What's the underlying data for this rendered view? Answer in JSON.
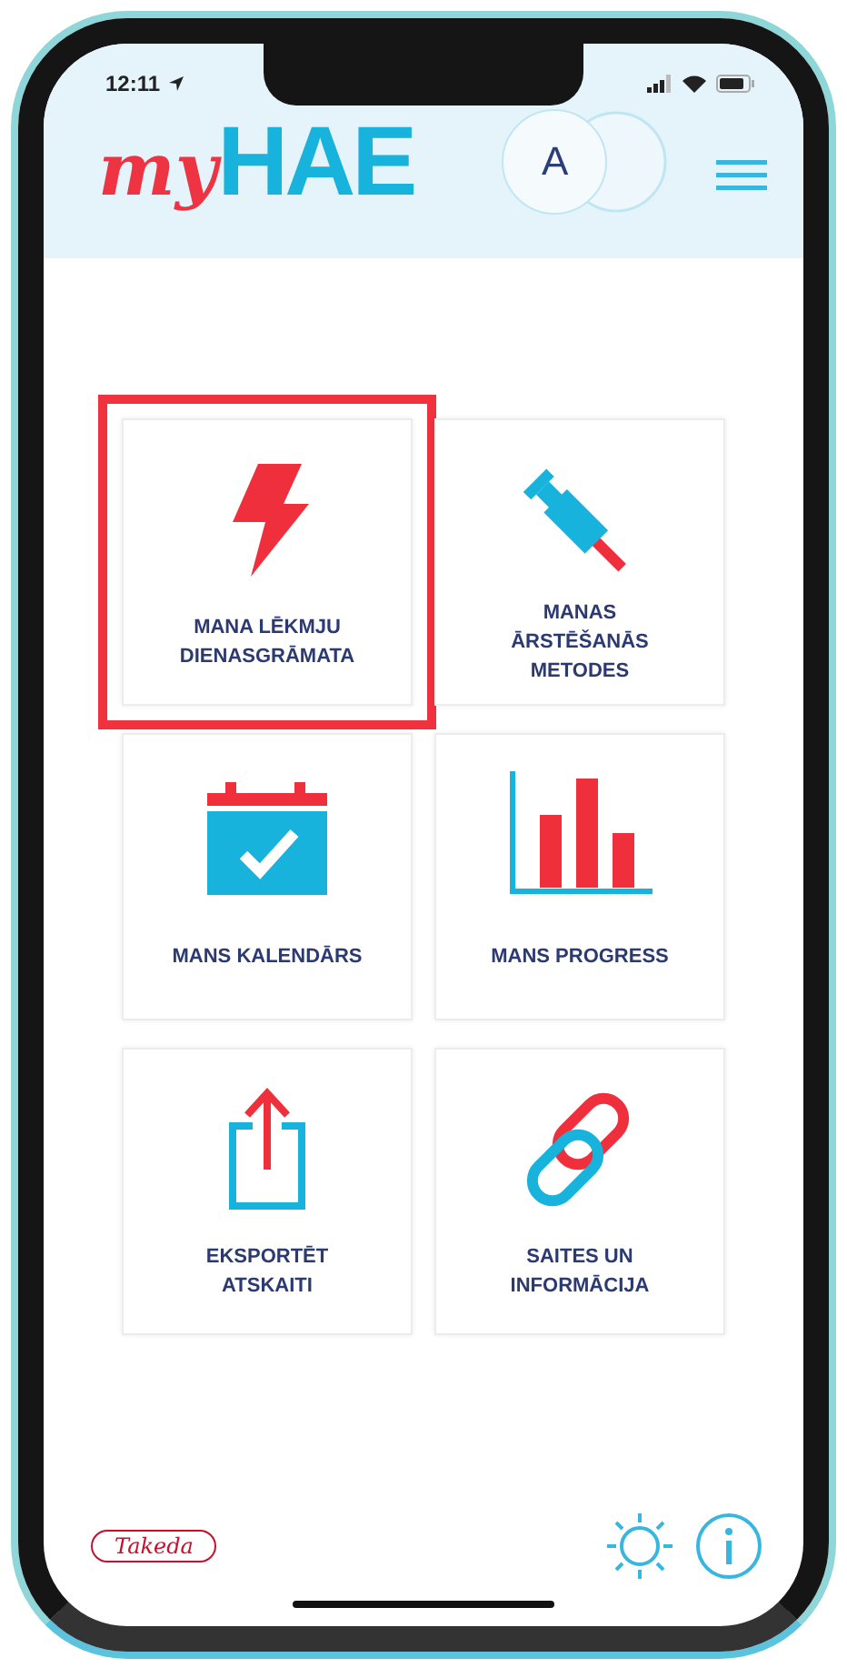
{
  "status_bar": {
    "time": "12:11"
  },
  "header": {
    "logo_script": "my",
    "logo_text": "HAE",
    "avatar": "A"
  },
  "tiles": [
    {
      "label": "MANA LĒKMJU\nDIENASGRĀMATA",
      "highlighted": true
    },
    {
      "label": "MANAS\nĀRSTĒŠANĀS\nMETODES",
      "highlighted": false
    },
    {
      "label": "MANS KALENDĀRS",
      "highlighted": false
    },
    {
      "label": "MANS PROGRESS",
      "highlighted": false
    },
    {
      "label": "EKSPORTĒT\nATSKAITI",
      "highlighted": false
    },
    {
      "label": "SAITES UN\nINFORMĀCIJA",
      "highlighted": false
    }
  ],
  "footer": {
    "logo": "Takeda"
  }
}
